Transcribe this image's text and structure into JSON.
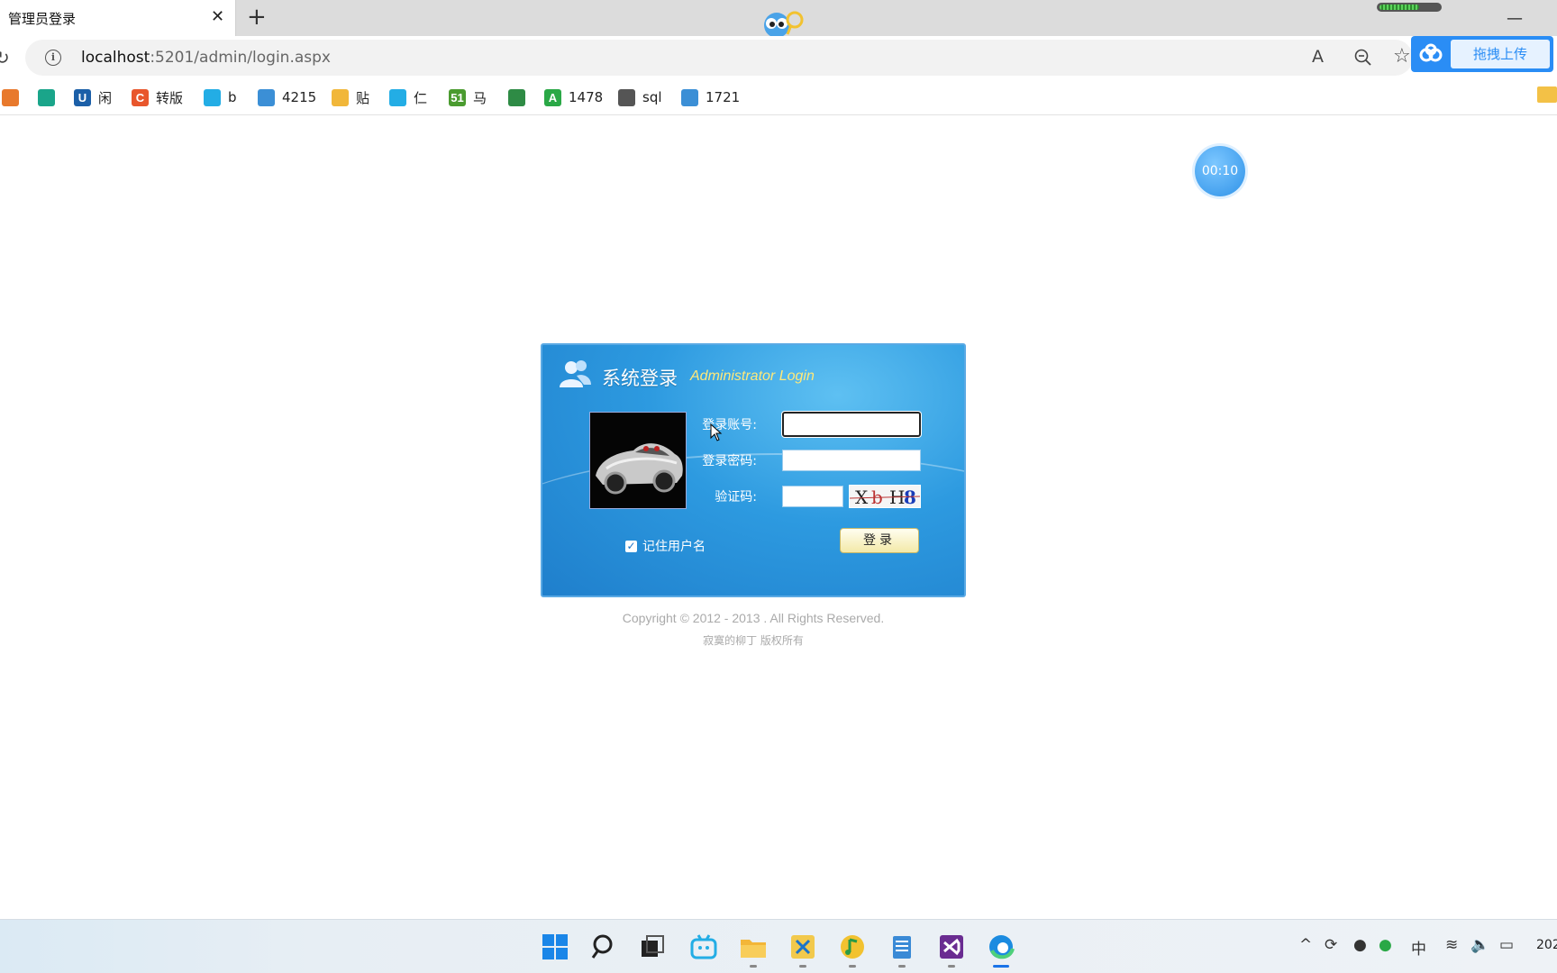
{
  "browser": {
    "tab_title": "管理员登录",
    "tab_close": "✕",
    "new_tab": "+",
    "minimize": "—",
    "url_host": "localhost",
    "url_path": ":5201/admin/login.aspx",
    "read_aloud": "A",
    "baidu_upload": "拖拽上传"
  },
  "bookmarks": [
    {
      "label": "",
      "icon": "c-orange-icon",
      "color": "#e8792c"
    },
    {
      "label": "",
      "icon": "green-circle-icon",
      "color": "#1aa58a"
    },
    {
      "label": "闲",
      "icon": "u-icon",
      "color": "#1b5fa8",
      "glyph": "U"
    },
    {
      "label": "转版",
      "icon": "csdn-icon",
      "color": "#e8562c",
      "glyph": "C"
    },
    {
      "label": "b",
      "icon": "bilibili-icon",
      "color": "#23ade5"
    },
    {
      "label": "4215",
      "icon": "book-icon",
      "color": "#3b8fd6"
    },
    {
      "label": "贴",
      "icon": "envelope-icon",
      "color": "#f1b73a"
    },
    {
      "label": "仁",
      "icon": "bilibili-icon",
      "color": "#23ade5"
    },
    {
      "label": "马",
      "icon": "51-icon",
      "color": "#4a9b2f",
      "glyph": "51"
    },
    {
      "label": "",
      "icon": "shield-icon",
      "color": "#2e8b45"
    },
    {
      "label": "1478",
      "icon": "a-icon",
      "color": "#2aa846",
      "glyph": "A"
    },
    {
      "label": "sql",
      "icon": "page-icon",
      "color": "#555"
    },
    {
      "label": "1721",
      "icon": "book-icon",
      "color": "#3b8fd6"
    }
  ],
  "timer": "00:10",
  "login": {
    "title": "系统登录",
    "subtitle": "Administrator Login",
    "account_label": "登录账号:",
    "password_label": "登录密码:",
    "captcha_label": "验证码:",
    "captcha_text": [
      "X",
      "b",
      "H",
      "8"
    ],
    "remember_label": "记住用户名",
    "remember_checked": true,
    "submit_label": "登录"
  },
  "footer": {
    "copyright": "Copyright © 2012 - 2013 . All Rights Reserved.",
    "owner": "寂寞的柳丁 版权所有"
  },
  "taskbar": {
    "ime": "中",
    "clock": "202"
  }
}
